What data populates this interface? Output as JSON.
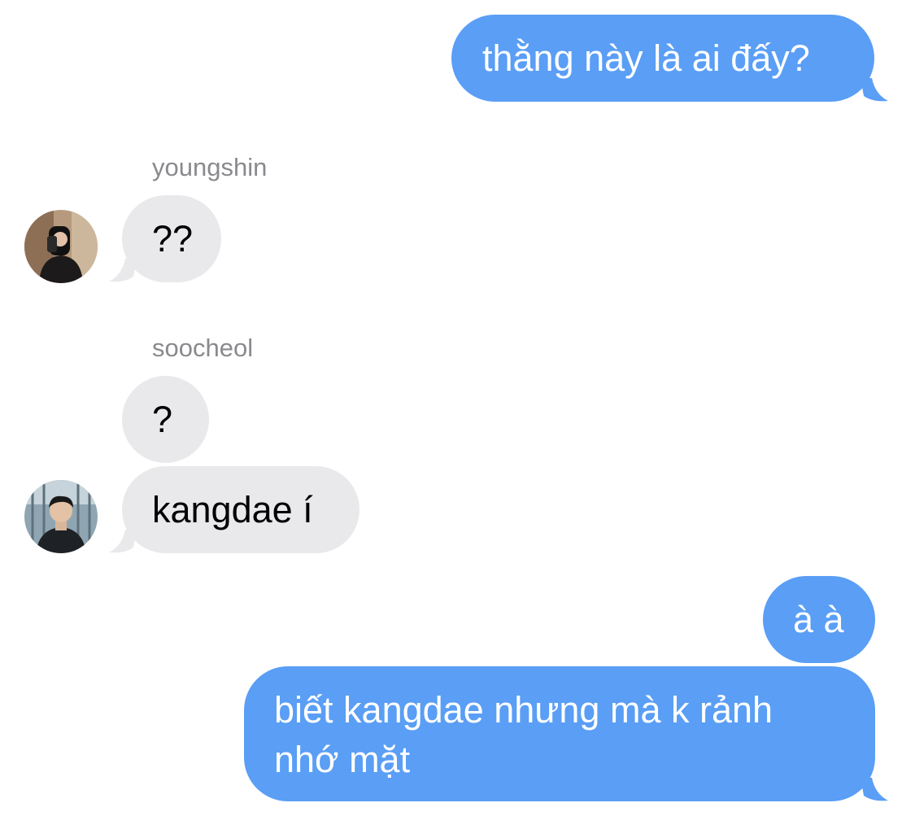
{
  "thread": {
    "messages": [
      {
        "id": "m1",
        "direction": "outgoing",
        "text": "thằng này là ai đấy?"
      },
      {
        "id": "m2",
        "direction": "incoming",
        "sender": "youngshin",
        "text": "??"
      },
      {
        "id": "m3",
        "direction": "incoming",
        "sender": "soocheol",
        "text": "?"
      },
      {
        "id": "m4",
        "direction": "incoming",
        "sender": "soocheol",
        "text": "kangdae í"
      },
      {
        "id": "m5",
        "direction": "outgoing",
        "text": "à à"
      },
      {
        "id": "m6",
        "direction": "outgoing",
        "text": "biết kangdae nhưng mà k rảnh nhớ mặt",
        "lines": [
          "biết kangdae nhưng mà k rảnh",
          "nhớ mặt"
        ]
      }
    ],
    "senders": {
      "youngshin": "youngshin",
      "soocheol": "soocheol"
    },
    "colors": {
      "outgoing_bubble": "#5a9ef5",
      "incoming_bubble": "#e9e9eb",
      "outgoing_text": "#ffffff",
      "incoming_text": "#000000",
      "sender_label": "#8a8a8e"
    },
    "icons": {
      "youngshin_avatar": "user-photo-avatar",
      "soocheol_avatar": "user-photo-avatar"
    }
  }
}
